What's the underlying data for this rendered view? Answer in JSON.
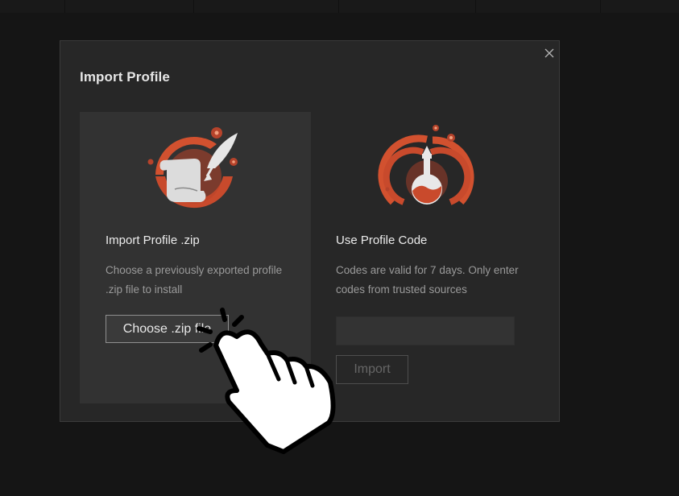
{
  "modal": {
    "title": "Import Profile",
    "close_icon": "close-icon"
  },
  "zip_option": {
    "icon": "scroll-quill-icon",
    "heading": "Import Profile .zip",
    "description": "Choose a previously exported profile .zip file to install",
    "button_label": "Choose .zip file"
  },
  "code_option": {
    "icon": "potion-flask-icon",
    "heading": "Use Profile Code",
    "description": "Codes are valid for 7 days. Only enter codes from trusted sources",
    "input_value": "",
    "input_placeholder": "",
    "button_label": "Import"
  },
  "overlay": {
    "cursor_icon": "pointing-hand-click-icon"
  },
  "colors": {
    "accent": "#d2512f",
    "modal_bg": "#272727",
    "card_bg": "#323232"
  }
}
